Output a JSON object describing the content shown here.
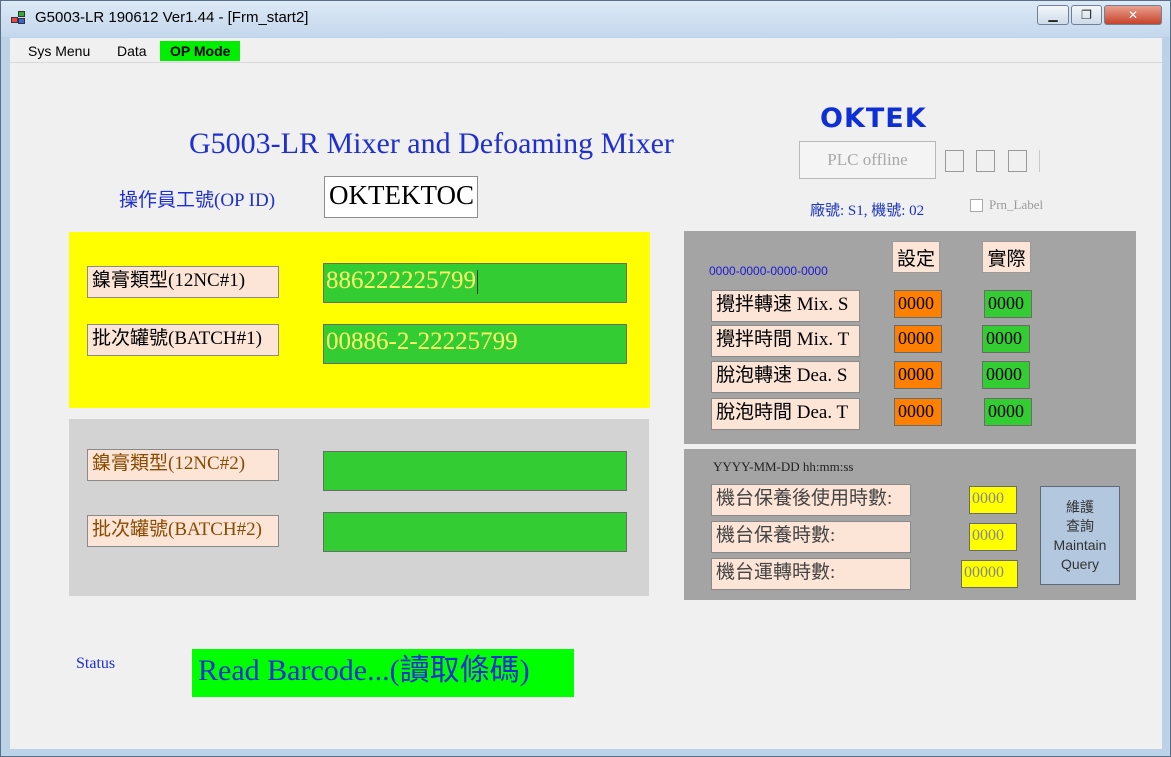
{
  "window": {
    "title": "G5003-LR 190612 Ver1.44 - [Frm_start2]",
    "minimize_glyph": "▁",
    "maximize_glyph": "❐",
    "close_glyph": "✕"
  },
  "menu": {
    "sys_menu": "Sys Menu",
    "data": "Data",
    "op_mode": "OP Mode"
  },
  "header": {
    "app_title": "G5003-LR  Mixer and Defoaming Mixer",
    "logo": "OKTEK",
    "plc_status": "PLC offline",
    "factory_info": "廠號: S1, 機號: 02",
    "prn_label": "Prn_Label"
  },
  "operator": {
    "label": "操作員工號(OP ID)",
    "value": "OKTEKTOC"
  },
  "batch1": {
    "type_label": "鎳膏類型(12NC#1)",
    "type_value": "886222225799",
    "batch_label": "批次罐號(BATCH#1)",
    "batch_value": "00886-2-22225799"
  },
  "batch2": {
    "type_label": "鎳膏類型(12NC#2)",
    "type_value": "",
    "batch_label": "批次罐號(BATCH#2)",
    "batch_value": ""
  },
  "params": {
    "setting_header": "設定",
    "actual_header": "實際",
    "code": "0000-0000-0000-0000",
    "rows": [
      {
        "label": "攪拌轉速 Mix. S",
        "set": "0000",
        "actual": "0000"
      },
      {
        "label": "攪拌時間 Mix. T",
        "set": "0000",
        "actual": "0000"
      },
      {
        "label": "脫泡轉速 Dea. S",
        "set": "0000",
        "actual": "0000"
      },
      {
        "label": "脫泡時間 Dea. T",
        "set": "0000",
        "actual": "0000"
      }
    ]
  },
  "maintenance": {
    "datetime_format": "YYYY-MM-DD hh:mm:ss",
    "rows": [
      {
        "label": "機台保養後使用時數:",
        "value": "0000"
      },
      {
        "label": "機台保養時數:",
        "value": "0000"
      },
      {
        "label": "機台運轉時數:",
        "value": "00000"
      }
    ],
    "button_line1": "維護",
    "button_line2": "查詢",
    "button_line3": "Maintain",
    "button_line4": "Query"
  },
  "status": {
    "label": "Status",
    "message": "Read  Barcode...(讀取條碼)"
  },
  "colors": {
    "title_blue": "#1f2fd0",
    "logo_blue": "#0f2fd6",
    "panel_yellow": "#ffff00",
    "input_green": "#33cc33",
    "status_green": "#00ff00",
    "set_orange": "#ff8000",
    "label_peach": "#fce4d6"
  }
}
